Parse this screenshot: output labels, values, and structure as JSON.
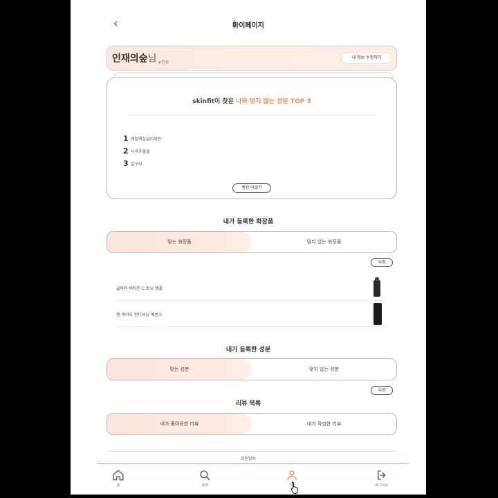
{
  "header": {
    "title": "마이페이지",
    "back_symbol": "‹"
  },
  "profile": {
    "name": "인재의숲",
    "name_suffix": "님",
    "tag": "#건성",
    "edit_label": "내 정보 수정하기"
  },
  "top3": {
    "title_prefix": "skinfit이 찾은 ",
    "title_accent": "나와 맞지 않는 성분 TOP 3",
    "items": [
      {
        "rank": "1",
        "name": "에틸헥실글리세린"
      },
      {
        "rank": "2",
        "name": "사과추출물"
      },
      {
        "rank": "3",
        "name": "살구씨"
      }
    ],
    "more_label": "랭킹 더보기"
  },
  "cosmetics": {
    "title": "내가 등록한 화장품",
    "tab_match": "맞는 화장품",
    "tab_nomatch": "맞지 않는 화장품",
    "edit_label": "수정",
    "products": [
      {
        "name": "글루타 비타민 C 토닝 앰플"
      },
      {
        "name": "앤 바이오 컨디셔닝 에센스"
      }
    ]
  },
  "ingredients": {
    "title": "내가 등록한 성분",
    "tab_match": "맞는 성분",
    "tab_nomatch": "맞지 않는 성분",
    "edit_label": "수정"
  },
  "reviews": {
    "title": "리뷰 목록",
    "tab_liked": "내가 좋아요한 리뷰",
    "tab_written": "내가 작성한 리뷰"
  },
  "footer": {
    "withdraw_label": "회원탈퇴"
  },
  "nav": {
    "home_label": "홈",
    "search_label": "검색",
    "mypage_label": "마이",
    "logout_label": "로그아웃"
  },
  "colors": {
    "accent": "#f08a5d",
    "highlight_bg": "#fbe6db"
  }
}
